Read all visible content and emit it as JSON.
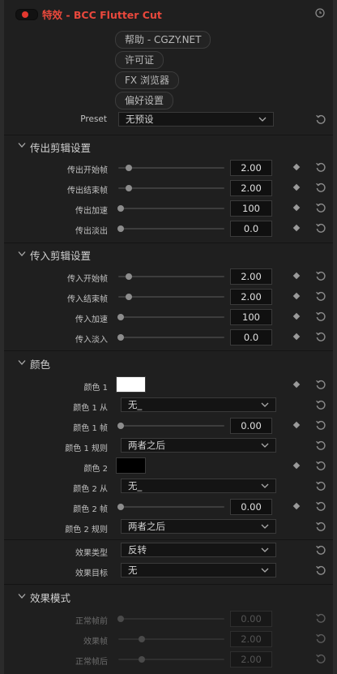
{
  "header": {
    "title": "特效 - BCC Flutter Cut"
  },
  "buttons": {
    "help": "帮助 - CGZY.NET",
    "license": "许可证",
    "fx_browser": "FX 浏览器",
    "preferences": "偏好设置"
  },
  "preset": {
    "label": "Preset",
    "value": "无预设"
  },
  "transition_out": {
    "title": "传出剪辑设置",
    "params": [
      {
        "label": "传出开始帧",
        "value": "2.00",
        "slider": 0.08
      },
      {
        "label": "传出结束帧",
        "value": "2.00",
        "slider": 0.08
      },
      {
        "label": "传出加速",
        "value": "100",
        "slider": 0.0
      },
      {
        "label": "传出淡出",
        "value": "0.0",
        "slider": 0.0
      }
    ]
  },
  "transition_in": {
    "title": "传入剪辑设置",
    "params": [
      {
        "label": "传入开始帧",
        "value": "2.00",
        "slider": 0.08
      },
      {
        "label": "传入结束帧",
        "value": "2.00",
        "slider": 0.08
      },
      {
        "label": "传入加速",
        "value": "100",
        "slider": 0.0
      },
      {
        "label": "传入淡入",
        "value": "0.0",
        "slider": 0.0
      }
    ]
  },
  "color": {
    "title": "颜色",
    "color1_label": "颜色 1",
    "color1_value": "#ffffff",
    "color1_from_label": "颜色 1 从",
    "color1_from_value": "无_",
    "color1_frame_label": "颜色 1 帧",
    "color1_frame_value": "0.00",
    "color1_frame_slider": 0.0,
    "color1_rule_label": "颜色 1 规则",
    "color1_rule_value": "两者之后",
    "color2_label": "颜色 2",
    "color2_value": "#000000",
    "color2_from_label": "颜色 2 从",
    "color2_from_value": "无_",
    "color2_frame_label": "颜色 2 帧",
    "color2_frame_value": "0.00",
    "color2_frame_slider": 0.0,
    "color2_rule_label": "颜色 2 规则",
    "color2_rule_value": "两者之后"
  },
  "effect": {
    "type_label": "效果类型",
    "type_value": "反转",
    "target_label": "效果目标",
    "target_value": "无"
  },
  "effect_mode": {
    "title": "效果模式",
    "params": [
      {
        "label": "正常帧前",
        "value": "0.00",
        "slider": 0.0
      },
      {
        "label": "效果帧",
        "value": "2.00",
        "slider": 0.2
      },
      {
        "label": "正常帧后",
        "value": "2.00",
        "slider": 0.2
      }
    ]
  },
  "colors": {
    "accent": "#e9483c",
    "background": "#1f1f1f"
  }
}
